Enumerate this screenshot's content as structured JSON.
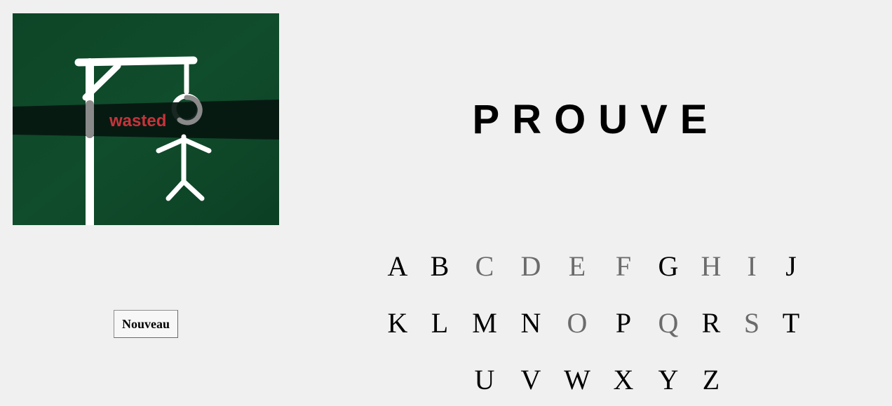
{
  "game": {
    "image": {
      "caption": "wasted",
      "colors": {
        "background": "#0f4a2a",
        "band": "#061710",
        "chalk": "#ffffff",
        "caption": "#c8333a"
      }
    },
    "word": "PROUVE",
    "new_button_label": "Nouveau",
    "keyboard": {
      "rows": [
        [
          {
            "letter": "A",
            "used": false
          },
          {
            "letter": "B",
            "used": false
          },
          {
            "letter": "C",
            "used": true
          },
          {
            "letter": "D",
            "used": true
          },
          {
            "letter": "E",
            "used": true
          },
          {
            "letter": "F",
            "used": true
          },
          {
            "letter": "G",
            "used": false
          },
          {
            "letter": "H",
            "used": true
          },
          {
            "letter": "I",
            "used": true
          },
          {
            "letter": "J",
            "used": false
          }
        ],
        [
          {
            "letter": "K",
            "used": false
          },
          {
            "letter": "L",
            "used": false
          },
          {
            "letter": "M",
            "used": false
          },
          {
            "letter": "N",
            "used": false
          },
          {
            "letter": "O",
            "used": true
          },
          {
            "letter": "P",
            "used": false
          },
          {
            "letter": "Q",
            "used": true
          },
          {
            "letter": "R",
            "used": false
          },
          {
            "letter": "S",
            "used": true
          },
          {
            "letter": "T",
            "used": false
          }
        ],
        [
          {
            "letter": "U",
            "used": false
          },
          {
            "letter": "V",
            "used": false
          },
          {
            "letter": "W",
            "used": false
          },
          {
            "letter": "X",
            "used": false
          },
          {
            "letter": "Y",
            "used": false
          },
          {
            "letter": "Z",
            "used": false
          }
        ]
      ]
    },
    "colors": {
      "used_letter": "#6b6b6b",
      "available_letter": "#000000",
      "page_background": "#f0f0f0"
    }
  }
}
